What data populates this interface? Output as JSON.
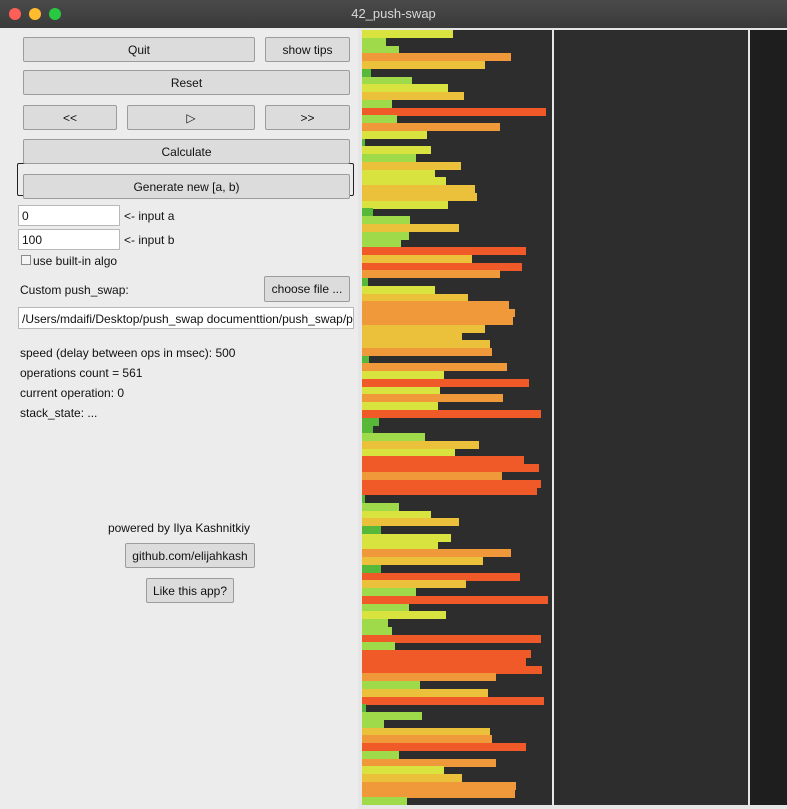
{
  "window": {
    "title": "42_push-swap"
  },
  "controls": {
    "quit_label": "Quit",
    "tips_label": "show tips",
    "reset_label": "Reset",
    "prev_label": "<<",
    "play_label": "▷",
    "next_label": ">>",
    "calculate_label": "Calculate",
    "generate_label": "Generate new [a, b)"
  },
  "inputs": {
    "a_value": "0",
    "a_label": "<- input a",
    "b_value": "100",
    "b_label": "<- input b"
  },
  "builtin": {
    "label": "use built-in algo",
    "checked": false
  },
  "custom": {
    "label": "Custom push_swap:",
    "choose_label": "choose file ...",
    "path": "/Users/mdaifi/Desktop/push_swap documenttion/push_swap/push"
  },
  "stats": {
    "speed": "speed (delay between ops in msec): 500",
    "ops_count": "operations count = 561",
    "current_op": "current operation: 0",
    "stack_state": "stack_state: ..."
  },
  "footer": {
    "powered": "powered by Ilya Kashnitkiy",
    "github_label": "github.com/elijahkash",
    "like_label": "Like this app?"
  },
  "stack_a": {
    "max": 100,
    "values": [
      49,
      13,
      20,
      80,
      66,
      5,
      27,
      46,
      55,
      16,
      99,
      19,
      74,
      35,
      1,
      37,
      29,
      53,
      39,
      45,
      61,
      62,
      46,
      6,
      26,
      52,
      25,
      21,
      88,
      59,
      86,
      74,
      3,
      39,
      57,
      79,
      82,
      81,
      66,
      54,
      69,
      70,
      4,
      78,
      44,
      90,
      42,
      76,
      41,
      96,
      9,
      6,
      34,
      63,
      50,
      87,
      95,
      75,
      96,
      94,
      1,
      20,
      37,
      52,
      10,
      48,
      41,
      80,
      65,
      10,
      85,
      56,
      29,
      100,
      25,
      45,
      14,
      16,
      96,
      18,
      91,
      88,
      97,
      72,
      31,
      68,
      98,
      2,
      32,
      12,
      69,
      70,
      88,
      20,
      72,
      44,
      54,
      83,
      82,
      24
    ],
    "colors": {
      "high": "#f05a28",
      "mid_high": "#f0993a",
      "mid": "#ebc13c",
      "mid_low": "#d9e33f",
      "low": "#9fda4a",
      "lowest": "#58b83a"
    }
  },
  "stack_b": {
    "values": []
  }
}
